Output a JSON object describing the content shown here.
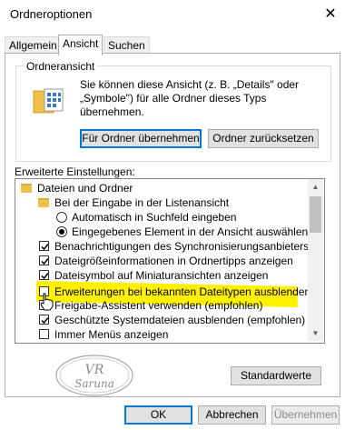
{
  "window": {
    "title": "Ordneroptionen",
    "close_glyph": "✕"
  },
  "tabs": [
    {
      "label": "Allgemein",
      "active": false
    },
    {
      "label": "Ansicht",
      "active": true
    },
    {
      "label": "Suchen",
      "active": false
    }
  ],
  "folder_view": {
    "title": "Ordneransicht",
    "description_line1": "Sie können diese Ansicht (z. B. „Details\" oder",
    "description_line2": "„Symbole\") für alle Ordner dieses Typs übernehmen.",
    "apply_button": "Für Ordner übernehmen",
    "reset_button": "Ordner zurücksetzen"
  },
  "advanced": {
    "label": "Erweiterte Einstellungen:",
    "items": [
      {
        "kind": "folder",
        "text": "Dateien und Ordner"
      },
      {
        "kind": "folder",
        "text": "Bei der Eingabe in der Listenansicht"
      },
      {
        "kind": "radio",
        "checked": false,
        "text": "Automatisch in Suchfeld eingeben"
      },
      {
        "kind": "radio",
        "checked": true,
        "text": "Eingegebenes Element in der Ansicht auswählen"
      },
      {
        "kind": "checkbox",
        "checked": true,
        "text": "Benachrichtigungen des Synchronisierungsanbieters anzeigen"
      },
      {
        "kind": "checkbox",
        "checked": true,
        "text": "Dateigrößeinformationen in Ordnertipps anzeigen"
      },
      {
        "kind": "checkbox",
        "checked": true,
        "text": "Dateisymbol auf Miniaturansichten anzeigen"
      },
      {
        "kind": "checkbox",
        "checked": false,
        "text": "Erweiterungen bei bekannten Dateitypen ausblenden"
      },
      {
        "kind": "checkbox",
        "checked": true,
        "text": "Freigabe-Assistent verwenden (empfohlen)"
      },
      {
        "kind": "checkbox",
        "checked": true,
        "text": "Geschützte Systemdateien ausblenden (empfohlen)"
      },
      {
        "kind": "checkbox",
        "checked": false,
        "text": "Immer Menüs anzeigen"
      }
    ],
    "defaults_button": "Standardwerte"
  },
  "watermark": {
    "line1": "VR",
    "line2": "Saruna"
  },
  "footer": {
    "ok": "OK",
    "cancel": "Abbrechen",
    "apply": "Übernehmen"
  },
  "colors": {
    "accent": "#0078d7",
    "highlight": "#fff000",
    "folder": "#f0c14a"
  }
}
